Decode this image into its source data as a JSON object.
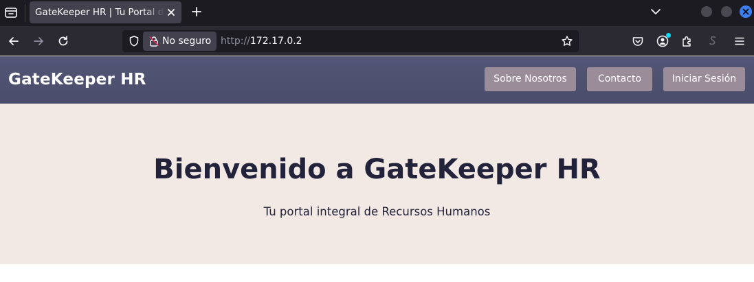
{
  "browser": {
    "tab": {
      "title": "GateKeeper HR | Tu Portal de Recursos Humanos"
    },
    "urlbar": {
      "security_label": "No seguro",
      "url_protocol": "http://",
      "url_host": "172.17.0.2"
    },
    "icons": {
      "tab_list": "tab-list-icon",
      "close_tab": "close-icon",
      "new_tab": "plus-icon",
      "list_all_tabs": "chevron-down-icon",
      "back": "arrow-left-icon",
      "forward": "arrow-right-icon",
      "reload": "reload-icon",
      "tracking_protection": "shield-icon",
      "insecure": "lock-slash-icon",
      "bookmark": "star-icon",
      "pocket": "pocket-icon",
      "account": "account-icon",
      "extensions": "puzzle-icon",
      "extension_s": "extension-s-icon",
      "menu": "hamburger-menu-icon"
    }
  },
  "site": {
    "logo": "GateKeeper HR",
    "nav": [
      {
        "label": "Sobre Nosotros"
      },
      {
        "label": "Contacto"
      },
      {
        "label": "Iniciar Sesión"
      }
    ],
    "hero": {
      "title": "Bienvenido a GateKeeper HR",
      "subtitle": "Tu portal integral de Recursos Humanos"
    }
  },
  "colors": {
    "header_bg": "#4e506f",
    "nav_button_bg": "#9a8c98",
    "hero_bg": "#f2e9e4",
    "text_dark": "#22223b",
    "browser_dark": "#1c1b22",
    "browser_toolbar": "#2b2a33"
  }
}
